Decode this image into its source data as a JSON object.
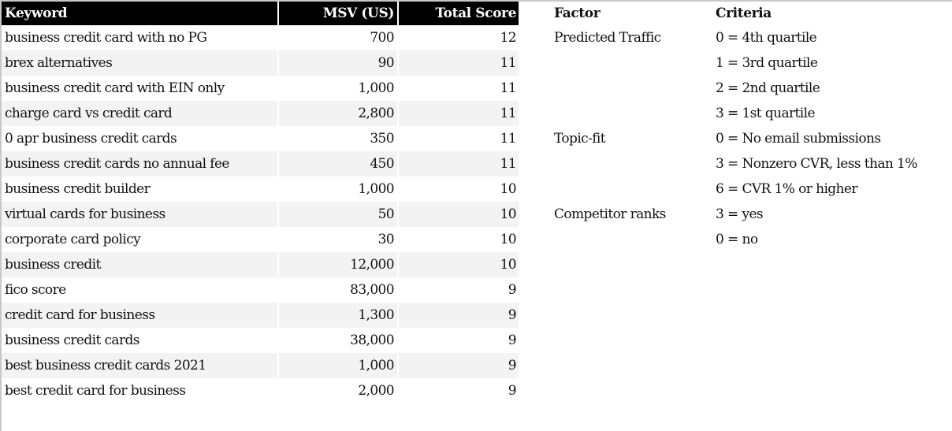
{
  "keyword_table": {
    "headers": [
      "Keyword",
      "MSV (US)",
      "Total Score"
    ],
    "rows": [
      {
        "keyword": "business credit card with no PG",
        "msv": "700",
        "score": "12"
      },
      {
        "keyword": "brex alternatives",
        "msv": "90",
        "score": "11"
      },
      {
        "keyword": "business credit card with EIN only",
        "msv": "1,000",
        "score": "11"
      },
      {
        "keyword": "charge card vs credit card",
        "msv": "2,800",
        "score": "11"
      },
      {
        "keyword": "0 apr business credit cards",
        "msv": "350",
        "score": "11"
      },
      {
        "keyword": "business credit cards no annual fee",
        "msv": "450",
        "score": "11"
      },
      {
        "keyword": "business credit builder",
        "msv": "1,000",
        "score": "10"
      },
      {
        "keyword": "virtual cards for business",
        "msv": "50",
        "score": "10"
      },
      {
        "keyword": "corporate card policy",
        "msv": "30",
        "score": "10"
      },
      {
        "keyword": "business credit",
        "msv": "12,000",
        "score": "10"
      },
      {
        "keyword": "fico score",
        "msv": "83,000",
        "score": "9"
      },
      {
        "keyword": "credit card for business",
        "msv": "1,300",
        "score": "9"
      },
      {
        "keyword": "business credit cards",
        "msv": "38,000",
        "score": "9"
      },
      {
        "keyword": "best business credit cards 2021",
        "msv": "1,000",
        "score": "9"
      },
      {
        "keyword": "best credit card for business",
        "msv": "2,000",
        "score": "9"
      }
    ]
  },
  "criteria_table": {
    "headers": [
      "Factor",
      "Criteria"
    ],
    "rows": [
      {
        "factor": "Predicted Traffic",
        "criteria": "0 = 4th quartile"
      },
      {
        "factor": "",
        "criteria": "1 = 3rd quartile"
      },
      {
        "factor": "",
        "criteria": "2 = 2nd quartile"
      },
      {
        "factor": "",
        "criteria": "3 = 1st quartile"
      },
      {
        "factor": "Topic-fit",
        "criteria": "0 = No email submissions"
      },
      {
        "factor": "",
        "criteria": "3 = Nonzero CVR, less than 1%"
      },
      {
        "factor": "",
        "criteria": "6 = CVR 1% or higher"
      },
      {
        "factor": "Competitor ranks",
        "criteria": "3 = yes"
      },
      {
        "factor": "",
        "criteria": "0 = no"
      }
    ]
  },
  "colors": {
    "header_bg": "#000000",
    "header_text": "#ffffff",
    "alt_row_bg": "#f3f3f3"
  }
}
